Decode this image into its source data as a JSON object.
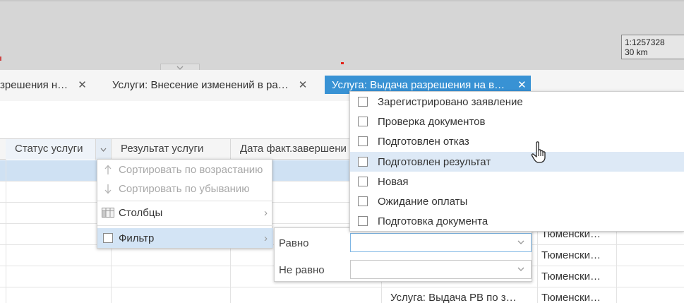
{
  "map": {
    "scale_ratio": "1:1257328",
    "scale_distance": "30 km"
  },
  "tabs": [
    {
      "label": "зрешения н…",
      "active": false
    },
    {
      "label": "Услуги: Внесение изменений в ра…",
      "active": false
    },
    {
      "label": "Услуга: Выдача разрешения на в…",
      "active": true
    }
  ],
  "tab_close": "✕",
  "grid": {
    "columns": [
      "Статус услуги",
      "Результат услуги",
      "Дата факт.завершени"
    ],
    "rows": [
      {
        "service": "",
        "region": "Тюменски…"
      },
      {
        "service": "",
        "region": "Тюменски…"
      },
      {
        "service": "",
        "region": "Тюменски…"
      },
      {
        "service": "Услуга: Выдача РВ по з…",
        "region": "Тюменски…"
      }
    ]
  },
  "column_menu": {
    "sort_asc": "Сортировать по возрастанию",
    "sort_desc": "Сортировать по убыванию",
    "columns": "Столбцы",
    "filter": "Фильтр"
  },
  "filter_panel": {
    "equals_label": "Равно",
    "not_equals_label": "Не равно",
    "equals_value": "",
    "not_equals_value": ""
  },
  "status_options": [
    "Зарегистрировано заявление",
    "Проверка документов",
    "Подготовлен отказ",
    "Подготовлен результат",
    "Новая",
    "Ожидание оплаты",
    "Подготовка документа"
  ],
  "colors": {
    "accent": "#3892d4",
    "selected_row": "#cfe1f3",
    "hover_item": "#dde9f6"
  }
}
